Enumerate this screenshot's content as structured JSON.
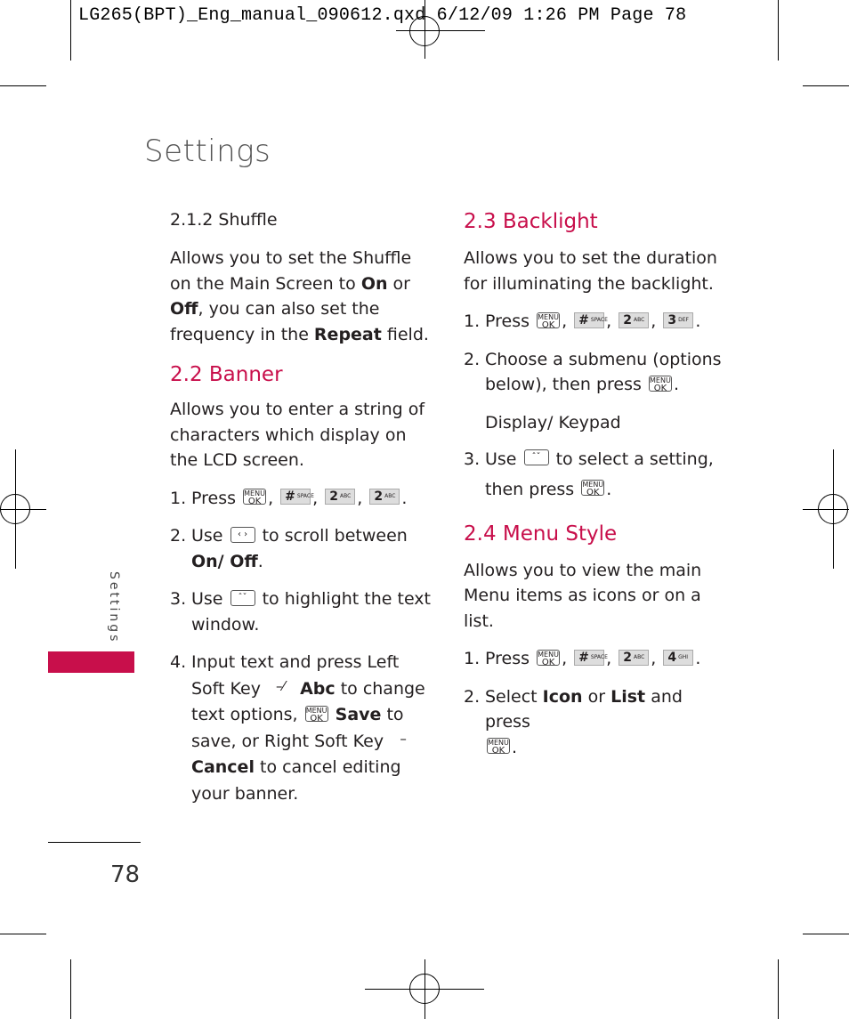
{
  "slug": "LG265(BPT)_Eng_manual_090612.qxd   6/12/09   1:26 PM   Page 78",
  "page_title": "Settings",
  "side_label": "Settings",
  "page_number": "78",
  "accent_color": "#c80f4b",
  "keys": {
    "menu_ok": {
      "top": "MENU",
      "main": "OK"
    },
    "space": {
      "main": "#",
      "sub": "SPACE"
    },
    "k2": {
      "main": "2",
      "sub": "ABC"
    },
    "k3": {
      "main": "3",
      "sub": "DEF"
    },
    "k4": {
      "main": "4",
      "sub": "GHI"
    },
    "nav_lr": "‹ ›",
    "nav_ud": "ˆˇ",
    "soft_left": "–⁄",
    "soft_right": "–"
  },
  "left": {
    "shuffle": {
      "heading": "2.1.2 Shuffle",
      "t1": "Allows you to set the Shuffle on the Main Screen to ",
      "on": "On",
      "t2": " or ",
      "off": "Off",
      "t3": ", you can also set the frequency in the ",
      "repeat": "Repeat",
      "t4": " field."
    },
    "banner": {
      "heading": "2.2 Banner",
      "desc": "Allows you to enter a string of characters which display on the LCD screen.",
      "s1_num": "1.",
      "s1_text": "Press",
      "s2_num": "2.",
      "s2_a": "Use",
      "s2_b": "to scroll between",
      "s2_bold": "On/ Off",
      "s3_num": "3.",
      "s3_a": "Use",
      "s3_b": "to highlight the text window.",
      "s4_num": "4.",
      "s4_a": "Input text and press Left Soft Key",
      "s4_abc": "Abc",
      "s4_b": "to change text options,",
      "s4_save": "Save",
      "s4_c": "to save, or Right Soft Key",
      "s4_cancel": "Cancel",
      "s4_d": "to cancel editing your banner."
    }
  },
  "right": {
    "backlight": {
      "heading": "2.3 Backlight",
      "desc": "Allows you to set the duration for illuminating the backlight.",
      "s1_num": "1.",
      "s1_text": "Press",
      "s2_num": "2.",
      "s2_text": "Choose a submenu (options below), then press",
      "sub": "Display/ Keypad",
      "s3_num": "3.",
      "s3_a": "Use",
      "s3_b": "to select a setting,",
      "s3_c": "then press"
    },
    "menu_style": {
      "heading": "2.4 Menu Style",
      "desc": "Allows you to view the main Menu items as icons or on a list.",
      "s1_num": "1.",
      "s1_text": "Press",
      "s2_num": "2.",
      "s2_a": "Select",
      "s2_icon": "Icon",
      "s2_or": "or",
      "s2_list": "List",
      "s2_b": "and press"
    }
  }
}
